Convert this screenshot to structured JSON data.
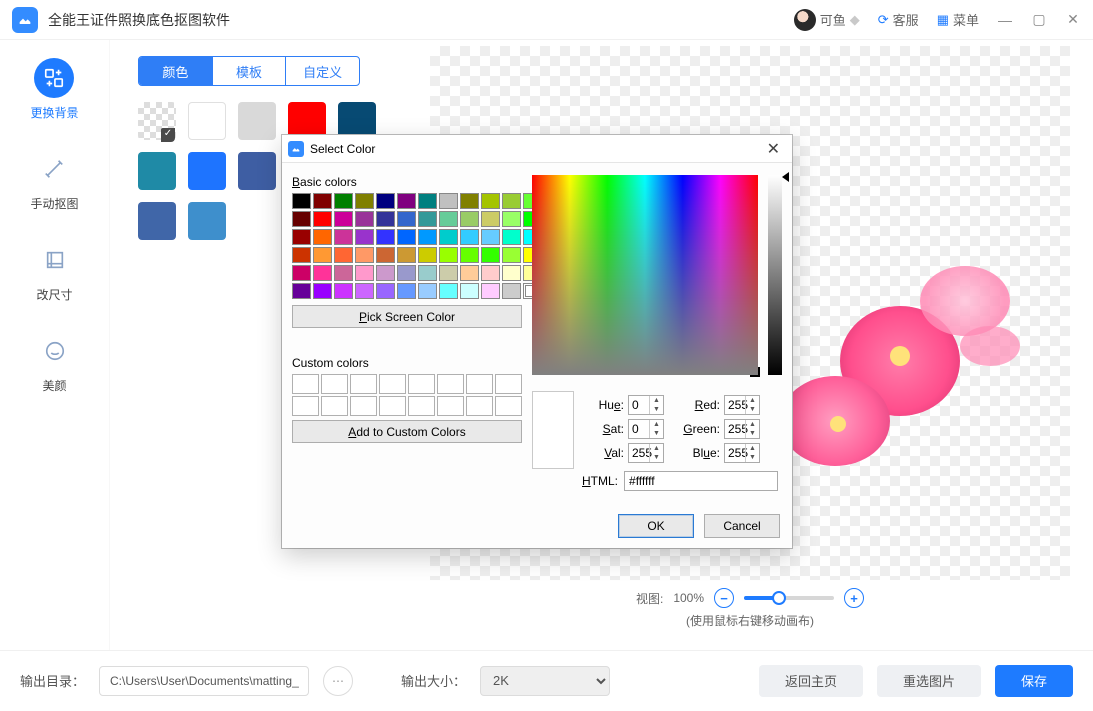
{
  "titlebar": {
    "app_name": "全能王证件照换底色抠图软件",
    "user_name": "可鱼",
    "support_label": "客服",
    "menu_label": "菜单"
  },
  "sidebar": {
    "items": [
      {
        "label": "更换背景"
      },
      {
        "label": "手动抠图"
      },
      {
        "label": "改尺寸"
      },
      {
        "label": "美颜"
      }
    ]
  },
  "tabs": {
    "color": "颜色",
    "template": "模板",
    "custom": "自定义"
  },
  "swatch_colors": [
    "trans",
    "#ffffff",
    "#d9d9d9",
    "#ff0000",
    "#074a73",
    "#1f8aa6",
    "#1e74ff",
    "#3e5ea3",
    "custom-wheel",
    "",
    "#de7d88",
    "#4066a8",
    "#3e8fcc"
  ],
  "zoom": {
    "label": "视图:",
    "value": "100%",
    "hint": "(使用鼠标右键移动画布)"
  },
  "bottom": {
    "out_dir_label": "输出目录：",
    "out_dir_value": "C:\\Users\\User\\Documents\\matting_",
    "out_size_label": "输出大小：",
    "out_size_value": "2K",
    "back_label": "返回主页",
    "reset_label": "重选图片",
    "save_label": "保存"
  },
  "dialog": {
    "title": "Select Color",
    "basic_label_pre": "B",
    "basic_label_rest": "asic colors",
    "pick_label_pre": "P",
    "pick_label_rest": "ick Screen Color",
    "custom_label": "Custom colors",
    "add_label_pre": "A",
    "add_label_rest": "dd to Custom Colors",
    "hue_label": "Hu",
    "hue_u": "e",
    "hue_val": "0",
    "sat_label_u": "S",
    "sat_label": "at:",
    "sat_val": "0",
    "val_label_u": "V",
    "val_label": "al:",
    "val_val": "255",
    "red_label_u": "R",
    "red_label": "ed:",
    "red_val": "255",
    "green_label_u": "G",
    "green_label": "reen:",
    "green_val": "255",
    "blue_label": "Bl",
    "blue_label_u": "u",
    "blue_label2": "e:",
    "blue_val": "255",
    "html_label": "HTML:",
    "html_u": "H",
    "html_rest": "TML:",
    "html_val": "#ffffff",
    "ok": "OK",
    "cancel": "Cancel",
    "basic_colors": [
      "#000000",
      "#800000",
      "#008000",
      "#808000",
      "#000080",
      "#800080",
      "#008080",
      "#c0c0c0",
      "#808000",
      "#a4c400",
      "#99cc33",
      "#66ff33",
      "#660000",
      "#ff0000",
      "#cc0099",
      "#993399",
      "#333399",
      "#3366cc",
      "#339999",
      "#66cc99",
      "#99cc66",
      "#cccc66",
      "#99ff66",
      "#00ff00",
      "#990000",
      "#ff6600",
      "#cc3399",
      "#9933cc",
      "#3333ff",
      "#0066ff",
      "#0099ff",
      "#00cccc",
      "#33ccff",
      "#66ccff",
      "#00ffcc",
      "#00ffff",
      "#cc3300",
      "#ff9933",
      "#ff6633",
      "#ff9966",
      "#cc6633",
      "#cc9933",
      "#cccc00",
      "#99ff00",
      "#66ff00",
      "#33ff00",
      "#99ff33",
      "#ffff00",
      "#cc0066",
      "#ff3399",
      "#cc6699",
      "#ff99cc",
      "#cc99cc",
      "#9999cc",
      "#99cccc",
      "#ccccaa",
      "#ffcc99",
      "#ffcccc",
      "#ffffcc",
      "#ffff99",
      "#660099",
      "#9900ff",
      "#cc33ff",
      "#cc66ff",
      "#9966ff",
      "#6699ff",
      "#99ccff",
      "#66ffff",
      "#ccffff",
      "#ffccff",
      "#cccccc",
      "#ffffff"
    ]
  }
}
